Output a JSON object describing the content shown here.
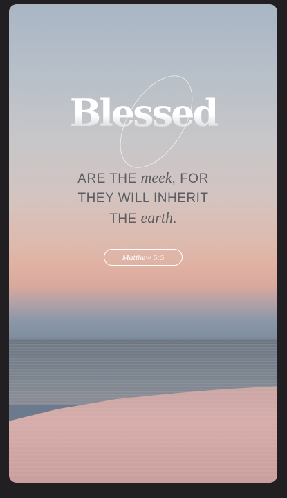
{
  "headline": "Blessed",
  "verse": {
    "line1_start": "ARE THE ",
    "line1_italic": "meek",
    "line1_end": ", FOR",
    "line2": "THEY WILL INHERIT",
    "line3_start": "THE ",
    "line3_italic": "earth",
    "line3_end": "."
  },
  "reference": "Matthew 5:5",
  "colors": {
    "background_frame": "#211f21",
    "text_gray": "#5b5d63",
    "sky_top": "#a9b6c5",
    "sky_horizon": "#e0b1a2",
    "sea": "#707a86",
    "shore": "#d6adab"
  }
}
